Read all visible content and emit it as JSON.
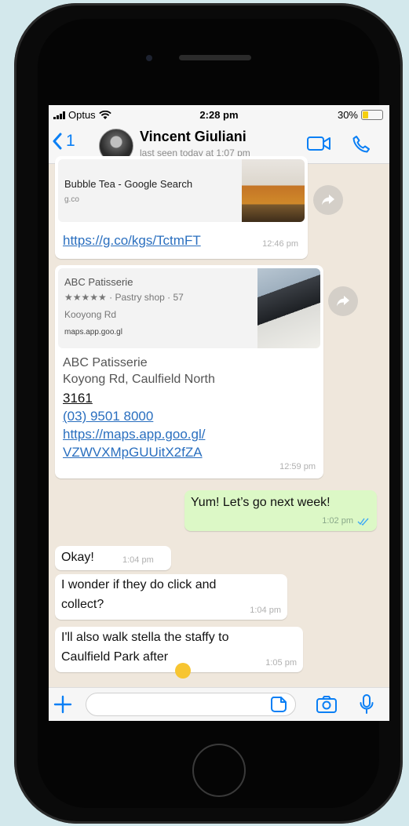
{
  "status": {
    "carrier": "Optus",
    "time": "2:28 pm",
    "battery": "30%",
    "battery_level": 0.3
  },
  "header": {
    "back_count": "1",
    "contact_name": "Vincent  Giuliani",
    "last_seen": "last seen today at 1:07 pm"
  },
  "messages": {
    "m1": {
      "title": "Bubble Tea - Google Search",
      "domain": "g.co",
      "link": "https://g.co/kgs/TctmFT",
      "time": "12:46 pm"
    },
    "m2": {
      "card_title": "ABC Patisserie",
      "card_rating": "★★★★★ · Pastry shop · 57",
      "card_address": "Kooyong Rd",
      "card_domain": "maps.app.goo.gl",
      "place": "ABC Patisserie",
      "address": "Koyong Rd, Caulfield North",
      "postcode": "3161",
      "phone": "(03) 9501 8000",
      "link1": "https://maps.app.goo.gl/",
      "link2": "VZWVXMpGUUitX2fZA",
      "time": "12:59 pm"
    },
    "m3": {
      "text": "Yum! Let’s go next week!",
      "time": "1:02 pm"
    },
    "m4": {
      "text": "Okay!",
      "time": "1:04 pm"
    },
    "m5": {
      "line1": "I wonder if they do click and",
      "line2": "collect?",
      "time": "1:04 pm"
    },
    "m6": {
      "line1": "I'll also walk stella the staffy to",
      "line2": "Caulfield Park after",
      "emoji": "😄",
      "time": "1:05 pm"
    }
  },
  "composer": {
    "value": "",
    "placeholder": ""
  },
  "colors": {
    "accent": "#0a7ff5",
    "outgoing": "#dcf8c6",
    "incoming": "#ffffff",
    "link": "#2a6fbf",
    "background": "#d3e8ec"
  },
  "icons": [
    "signal-icon",
    "wifi-icon",
    "battery-icon",
    "back-chevron-icon",
    "video-call-icon",
    "phone-call-icon",
    "forward-icon",
    "read-ticks-icon",
    "plus-icon",
    "sticker-icon",
    "camera-icon",
    "microphone-icon"
  ]
}
